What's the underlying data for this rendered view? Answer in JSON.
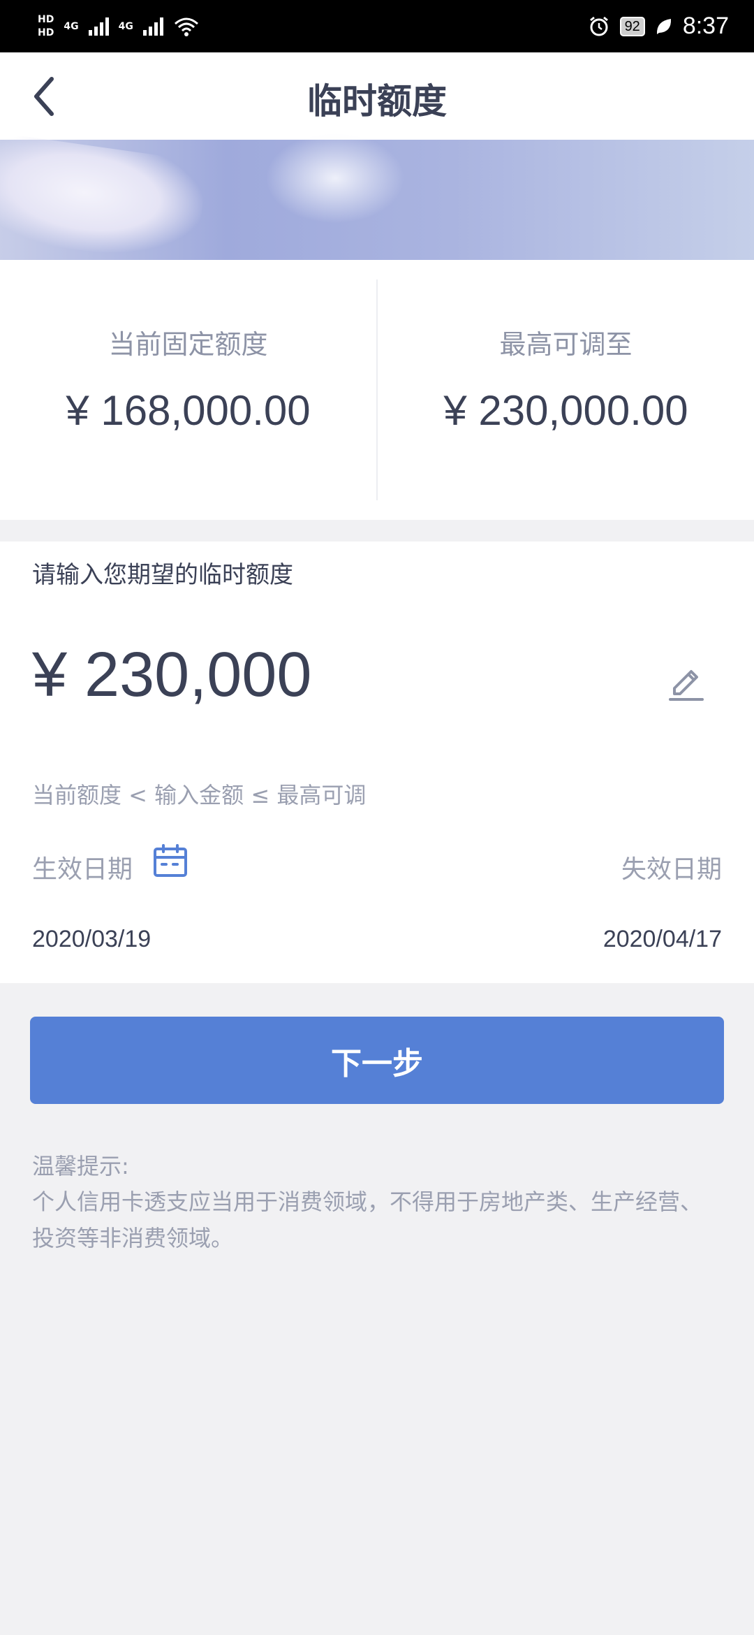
{
  "status_bar": {
    "hd1": "HD",
    "hd2": "HD",
    "net1": "4G",
    "net2": "4G",
    "battery": "92",
    "time": "8:37"
  },
  "nav": {
    "title": "临时额度"
  },
  "limits": {
    "current_label": "当前固定额度",
    "current_value": "¥ 168,000.00",
    "max_label": "最高可调至",
    "max_value": "¥ 230,000.00"
  },
  "form": {
    "prompt": "请输入您期望的临时额度",
    "amount": "¥ 230,000",
    "range_hint": "当前额度 < 输入金额 ≤ 最高可调",
    "effective_label": "生效日期",
    "expiry_label": "失效日期",
    "effective_date": "2020/03/19",
    "expiry_date": "2020/04/17"
  },
  "next_button": "下一步",
  "tips": {
    "title": "温馨提示:",
    "body": "个人信用卡透支应当用于消费领域，不得用于房地产类、生产经营、投资等非消费领域。"
  },
  "colors": {
    "accent": "#5580d6",
    "primary_text": "#3b4156",
    "secondary_text": "#9a9fb0",
    "background": "#f1f1f3"
  }
}
